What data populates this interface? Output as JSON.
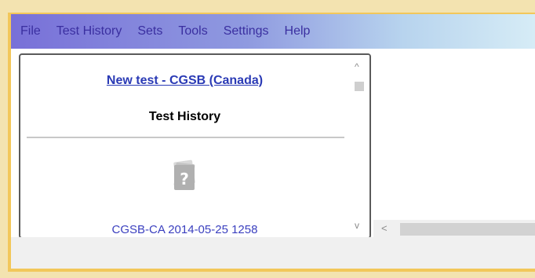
{
  "menu": {
    "items": [
      {
        "label": "File"
      },
      {
        "label": "Test History"
      },
      {
        "label": "Sets"
      },
      {
        "label": "Tools"
      },
      {
        "label": "Settings"
      },
      {
        "label": "Help"
      }
    ]
  },
  "panel": {
    "new_test_link": "New test - CGSB (Canada)",
    "section_title": "Test History",
    "history_items": [
      {
        "label": "CGSB-CA 2014-05-25 1258",
        "icon": "test-document-icon"
      }
    ]
  },
  "scrollbars": {
    "up_arrow": "^",
    "down_arrow": "v",
    "left_arrow": "<"
  },
  "colors": {
    "menu_gradient_start": "#7870d8",
    "menu_gradient_end": "#d6ecf6",
    "menu_text": "#3a2fa0",
    "link": "#2a3ab5",
    "window_border": "#f2c75a"
  }
}
